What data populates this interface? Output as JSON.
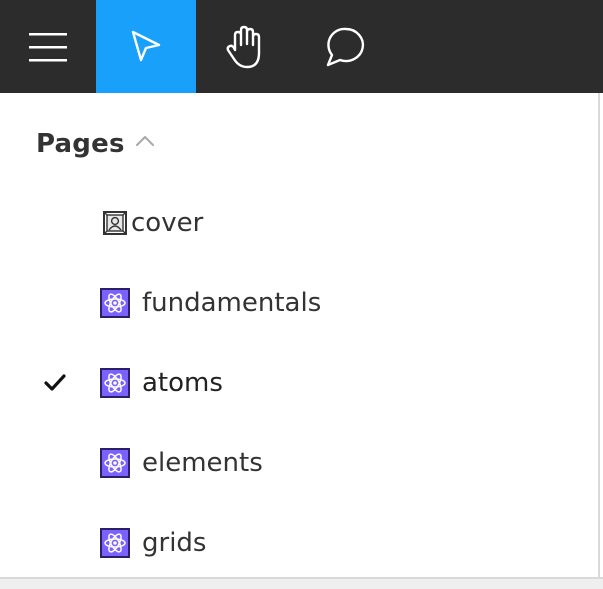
{
  "toolbar": {
    "tools": [
      {
        "id": "menu",
        "icon": "hamburger-menu-icon",
        "active": false
      },
      {
        "id": "move",
        "icon": "pointer-arrow-icon",
        "active": true
      },
      {
        "id": "hand",
        "icon": "hand-icon",
        "active": false
      },
      {
        "id": "comment",
        "icon": "comment-bubble-icon",
        "active": false
      }
    ],
    "active_color": "#18a0fb",
    "background_color": "#2c2c2c"
  },
  "pages_panel": {
    "title": "Pages",
    "expanded": true,
    "pages": [
      {
        "label": "cover",
        "icon": "picture-frame-icon",
        "selected": false
      },
      {
        "label": "fundamentals",
        "icon": "atom-icon",
        "selected": false
      },
      {
        "label": "atoms",
        "icon": "atom-icon",
        "selected": true
      },
      {
        "label": "elements",
        "icon": "atom-icon",
        "selected": false
      },
      {
        "label": "grids",
        "icon": "atom-icon",
        "selected": false
      }
    ]
  }
}
